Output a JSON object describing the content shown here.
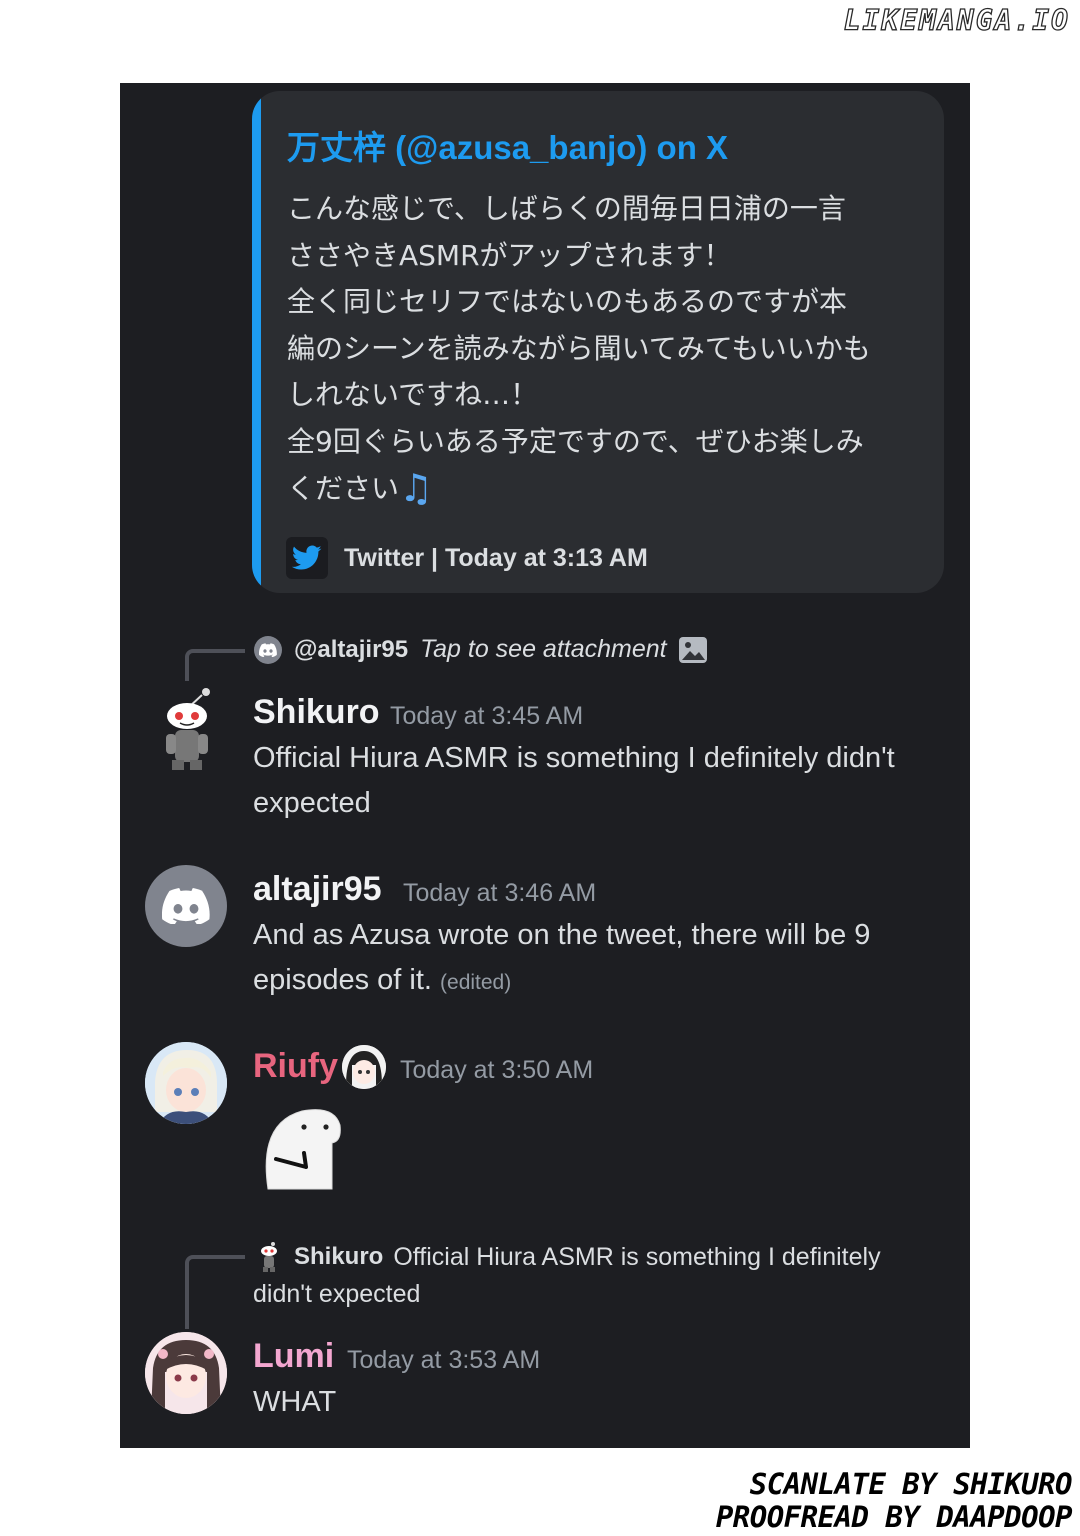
{
  "watermark": "LIKEMANGA.IO",
  "embed": {
    "author": "万丈梓 (@azusa_banjo) on X",
    "lines": [
      "こんな感じで、しばらくの間毎日日浦の一言",
      "ささやきASMRがアップされます！",
      "全く同じセリフではないのもあるのですが本",
      "編のシーンを読みながら聞いてみてもいいかも",
      "しれないですね…！",
      "全9回ぐらいある予定ですので、ぜひお楽しみ",
      "ください"
    ],
    "note_icon": "♫",
    "footer": "Twitter | Today at 3:13 AM",
    "icon": "twitter-bird-icon"
  },
  "messages": [
    {
      "reply": {
        "name": "@altajir95",
        "text": "Tap to see attachment"
      },
      "author": "Shikuro",
      "time": "Today at 3:45 AM",
      "lines": [
        "Official Hiura ASMR is something I definitely didn't",
        "expected"
      ]
    },
    {
      "author": "altajir95",
      "time": "Today at 3:46 AM",
      "lines": [
        "And as Azusa wrote on the tweet, there will be 9",
        "episodes of it."
      ],
      "edited": "(edited)"
    },
    {
      "author": "Riufy",
      "time": "Today at 3:50 AM",
      "author_color": "#e8657f",
      "sticker": "blob-sticker"
    },
    {
      "reply": {
        "name": "Shikuro",
        "text": "Official Hiura ASMR is something I definitely",
        "text2": "didn't expected"
      },
      "author": "Lumi",
      "time": "Today at 3:53 AM",
      "author_color": "#f3a7d0",
      "lines": [
        "WHAT"
      ]
    }
  ],
  "credits": [
    "SCANLATE BY SHIKURO",
    "PROOFREAD BY DAAPDOOP"
  ]
}
